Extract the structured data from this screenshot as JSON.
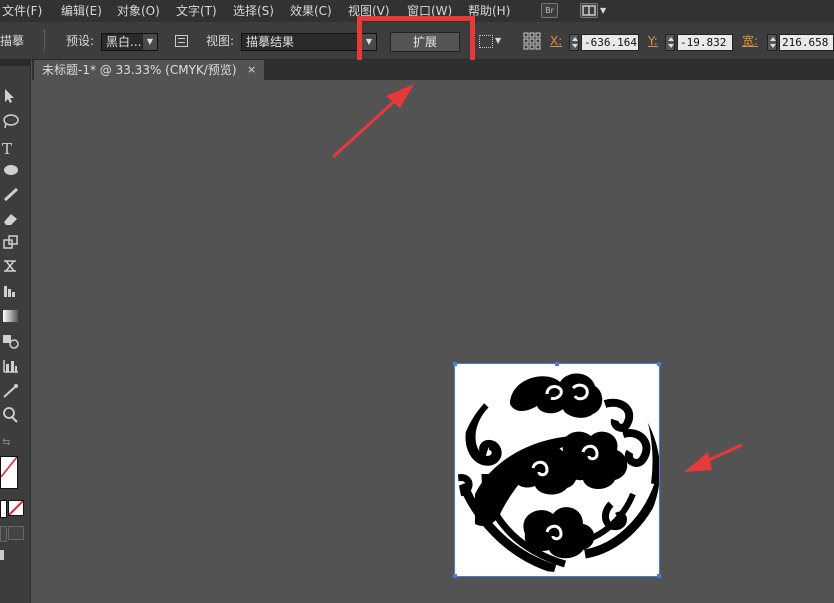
{
  "menubar": {
    "items": [
      "文件(F)",
      "编辑(E)",
      "对象(O)",
      "文字(T)",
      "选择(S)",
      "效果(C)",
      "视图(V)",
      "窗口(W)",
      "帮助(H)"
    ],
    "bridge_label": "Br"
  },
  "controlbar": {
    "panel_name": "描摹",
    "preset_label": "预设:",
    "preset_value": "黑白...",
    "view_label": "视图:",
    "view_value": "描摹结果",
    "expand_label": "扩展",
    "x_label": "X:",
    "x_value": "-636.164",
    "y_label": "Y:",
    "y_value": "-19.832",
    "w_label": "宽:",
    "w_value": "216.658"
  },
  "document": {
    "tab_title": "未标题-1* @ 33.33% (CMYK/预览)",
    "tab_close": "×"
  },
  "tools": {
    "type_tool": "T"
  },
  "colors": {
    "annotation": "#e8393a",
    "selection": "#4a7bd8",
    "canvas_bg": "#535353"
  }
}
